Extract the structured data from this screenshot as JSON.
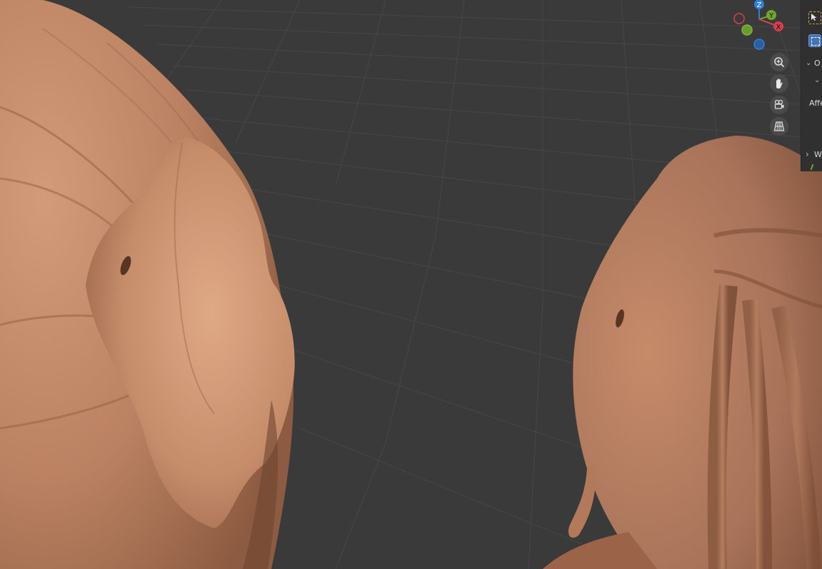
{
  "viewport": {
    "background_color": "#3a3a3a",
    "grid_color": "#4a4a4a",
    "mesh_color": "#c08767"
  },
  "gizmo": {
    "axes": [
      {
        "label": "Z",
        "color": "#2f7fd8"
      },
      {
        "label": "Y",
        "color": "#6ea72a"
      },
      {
        "label": "X",
        "color": "#d63e4c"
      }
    ]
  },
  "nav_buttons": [
    {
      "name": "zoom-icon"
    },
    {
      "name": "pan-hand-icon"
    },
    {
      "name": "camera-view-icon"
    },
    {
      "name": "perspective-grid-icon"
    }
  ],
  "side_panel": {
    "options_label": "O",
    "affect_label": "Affe",
    "workspace_label": "W"
  }
}
